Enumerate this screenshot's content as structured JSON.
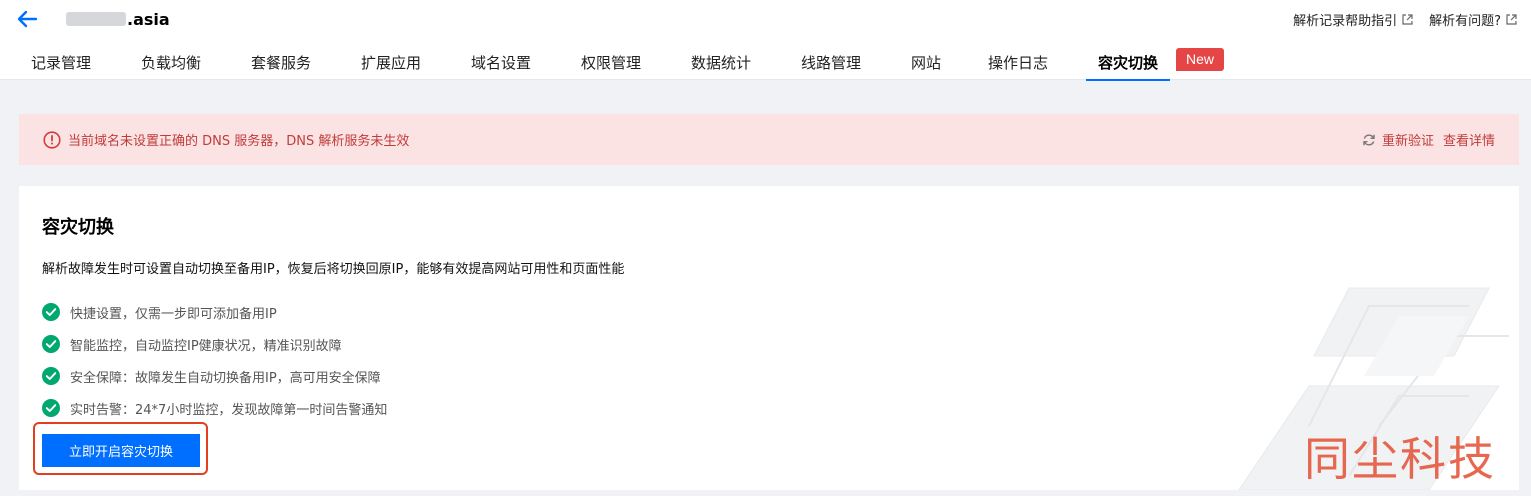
{
  "header": {
    "domain_suffix": ".asia",
    "help_links": [
      {
        "label": "解析记录帮助指引"
      },
      {
        "label": "解析有问题?"
      }
    ]
  },
  "tabs": [
    {
      "label": "记录管理",
      "active": false
    },
    {
      "label": "负载均衡",
      "active": false
    },
    {
      "label": "套餐服务",
      "active": false
    },
    {
      "label": "扩展应用",
      "active": false
    },
    {
      "label": "域名设置",
      "active": false
    },
    {
      "label": "权限管理",
      "active": false
    },
    {
      "label": "数据统计",
      "active": false
    },
    {
      "label": "线路管理",
      "active": false
    },
    {
      "label": "网站",
      "active": false
    },
    {
      "label": "操作日志",
      "active": false
    },
    {
      "label": "容灾切换",
      "active": true
    }
  ],
  "new_badge": "New",
  "alert": {
    "message": "当前域名未设置正确的 DNS 服务器，DNS 解析服务未生效",
    "revalidate_label": "重新验证",
    "details_label": "查看详情"
  },
  "card": {
    "title": "容灾切换",
    "description": "解析故障发生时可设置自动切换至备用IP，恢复后将切换回原IP，能够有效提高网站可用性和页面性能",
    "features": [
      "快捷设置，仅需一步即可添加备用IP",
      "智能监控，自动监控IP健康状况，精准识别故障",
      "安全保障：故障发生自动切换备用IP，高可用安全保障",
      "实时告警：24*7小时监控，发现故障第一时间告警通知"
    ],
    "button_label": "立即开启容灾切换"
  },
  "watermark": "同尘科技",
  "colors": {
    "accent": "#006eff",
    "alert_bg": "#fbe3e3",
    "alert_text": "#c23b3b",
    "success": "#00a870",
    "badge": "#e54545"
  }
}
